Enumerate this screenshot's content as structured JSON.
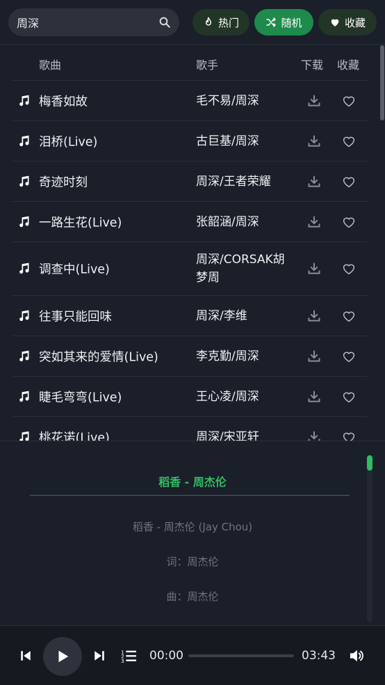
{
  "search": {
    "value": "周深",
    "placeholder": ""
  },
  "tabs": {
    "hot": "热门",
    "random": "随机",
    "favorites": "收藏"
  },
  "list": {
    "headers": {
      "song": "歌曲",
      "singer": "歌手",
      "download": "下载",
      "favorite": "收藏"
    },
    "rows": [
      {
        "song": "梅香如故",
        "singer": "毛不易/周深"
      },
      {
        "song": "泪桥(Live)",
        "singer": "古巨基/周深"
      },
      {
        "song": "奇迹时刻",
        "singer": "周深/王者荣耀"
      },
      {
        "song": "一路生花(Live)",
        "singer": "张韶涵/周深"
      },
      {
        "song": "调查中(Live)",
        "singer": "周深/CORSAK胡梦周"
      },
      {
        "song": "往事只能回味",
        "singer": "周深/李维"
      },
      {
        "song": "突如其来的爱情(Live)",
        "singer": "李克勤/周深"
      },
      {
        "song": "睫毛弯弯(Live)",
        "singer": "王心凌/周深"
      },
      {
        "song": "桃花诺(Live)",
        "singer": "周深/宋亚轩"
      }
    ]
  },
  "lyrics": {
    "now_playing": "稻香 - 周杰伦",
    "lines": [
      "稻香 - 周杰伦 (Jay Chou)",
      "词：周杰伦",
      "曲：周杰伦"
    ]
  },
  "player": {
    "current_time": "00:00",
    "total_time": "03:43",
    "progress": 0
  },
  "colors": {
    "accent": "#2fbd62",
    "random_active": "#1e8a4c",
    "background": "#1b1f2a"
  },
  "icons": {
    "search": "search-icon",
    "hot": "flame-icon",
    "random": "shuffle-icon",
    "favorites": "heart-icon",
    "row_note": "music-note-icon",
    "download": "download-icon",
    "favorite": "heart-outline-icon",
    "prev": "skip-previous-icon",
    "play": "play-icon",
    "next": "skip-next-icon",
    "playlist": "playlist-icon",
    "volume": "volume-icon"
  }
}
